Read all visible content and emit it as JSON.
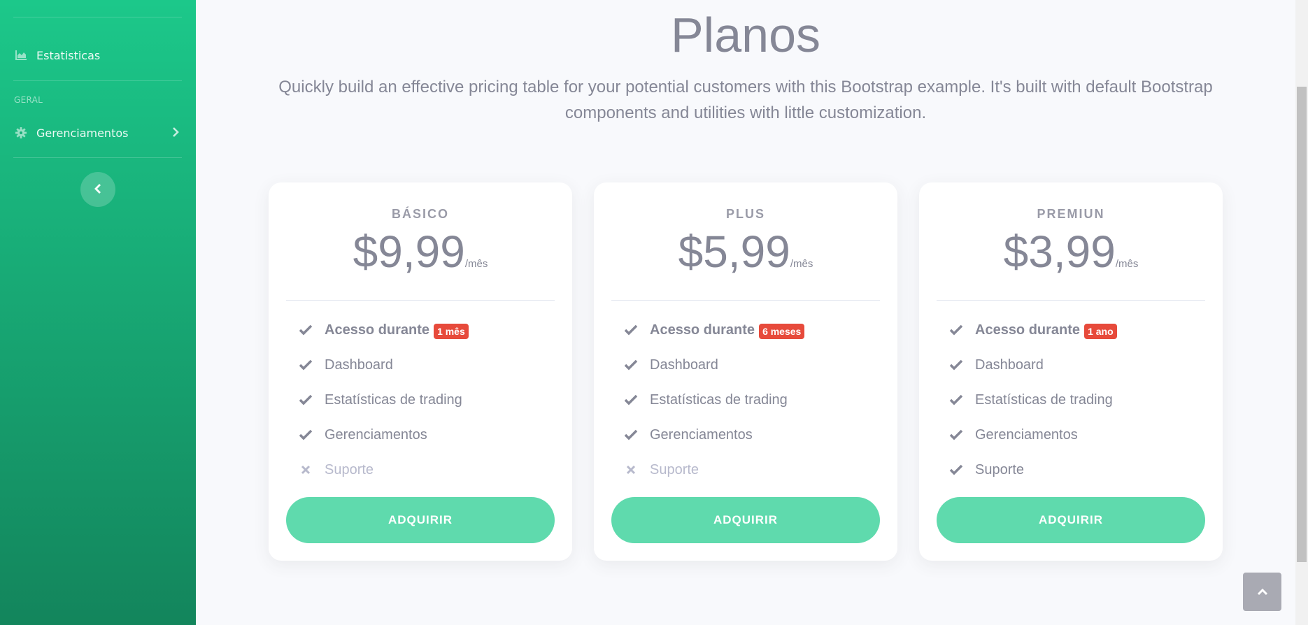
{
  "sidebar": {
    "items": [
      {
        "label": "Estatisticas",
        "icon": "chart-area-icon"
      }
    ],
    "heading": "GERAL",
    "collapsible": {
      "label": "Gerenciamentos",
      "icon": "cog-icon"
    },
    "toggle_icon": "chevron-left-icon"
  },
  "main": {
    "title": "Planos",
    "lead": "Quickly build an effective pricing table for your potential customers with this Bootstrap example. It's built with default Bootstrap components and utilities with little customization."
  },
  "plans": [
    {
      "name": "BÁSICO",
      "price": "$9,99",
      "period": "/mês",
      "features": [
        {
          "text": "Acesso durante",
          "badge": "1 mês",
          "included": true,
          "bold": true
        },
        {
          "text": "Dashboard",
          "included": true
        },
        {
          "text": "Estatísticas de trading",
          "included": true
        },
        {
          "text": "Gerenciamentos",
          "included": true
        },
        {
          "text": "Suporte",
          "included": false
        }
      ],
      "button": "ADQUIRIR"
    },
    {
      "name": "PLUS",
      "price": "$5,99",
      "period": "/mês",
      "features": [
        {
          "text": "Acesso durante",
          "badge": "6 meses",
          "included": true,
          "bold": true
        },
        {
          "text": "Dashboard",
          "included": true
        },
        {
          "text": "Estatísticas de trading",
          "included": true
        },
        {
          "text": "Gerenciamentos",
          "included": true
        },
        {
          "text": "Suporte",
          "included": false
        }
      ],
      "button": "ADQUIRIR"
    },
    {
      "name": "PREMIUN",
      "price": "$3,99",
      "period": "/mês",
      "features": [
        {
          "text": "Acesso durante",
          "badge": "1 ano",
          "included": true,
          "bold": true
        },
        {
          "text": "Dashboard",
          "included": true
        },
        {
          "text": "Estatísticas de trading",
          "included": true
        },
        {
          "text": "Gerenciamentos",
          "included": true
        },
        {
          "text": "Suporte",
          "included": true
        }
      ],
      "button": "ADQUIRIR"
    }
  ],
  "colors": {
    "sidebar_top": "#1cc88a",
    "sidebar_bottom": "#13855c",
    "button": "#5fdaad",
    "badge": "#e74a3b",
    "text": "#858796"
  },
  "scroll_top_icon": "chevron-up-icon"
}
